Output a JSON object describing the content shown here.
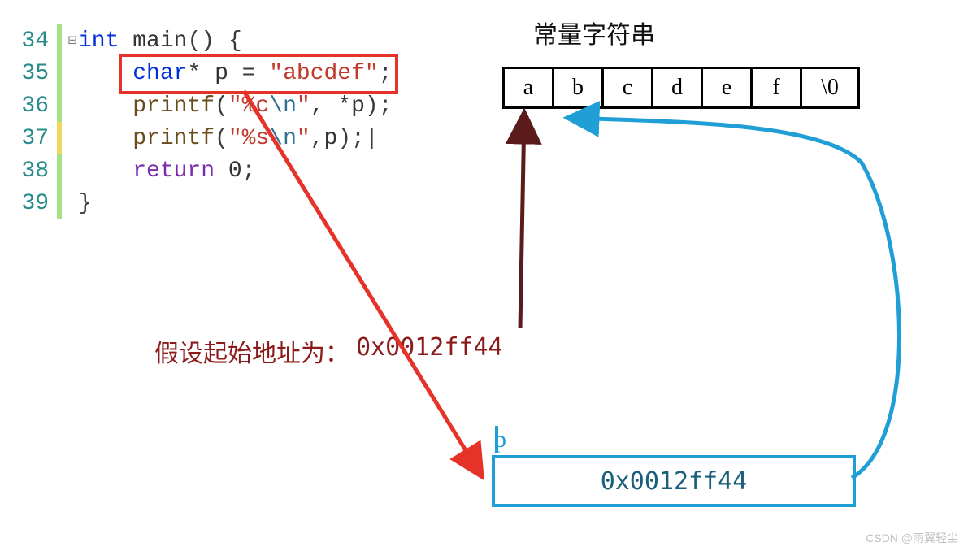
{
  "code": {
    "lines": [
      34,
      35,
      36,
      37,
      38,
      39
    ],
    "kw_int": "int",
    "fn_main": "main",
    "brace_open": "{",
    "brace_close": "}",
    "kw_char": "char",
    "star": "*",
    "id_p": "p",
    "eq": " = ",
    "str_abcdef": "\"abcdef\"",
    "semi": ";",
    "fn_printf": "printf",
    "paren_open": "(",
    "paren_close": ")",
    "fmt_c_open": "\"%c",
    "esc_n": "\\n",
    "fmt_close": "\"",
    "comma": ", ",
    "deref": "*p",
    "fmt_s_open": "\"%s",
    "arg_p": "p",
    "cursor": "|",
    "kw_return": "return",
    "zero": "0"
  },
  "mem": {
    "title": "常量字符串",
    "cells": [
      "a",
      "b",
      "c",
      "d",
      "e",
      "f",
      "\\0"
    ]
  },
  "pointer": {
    "label": "p",
    "value": "0x0012ff44"
  },
  "anno": {
    "label": "假设起始地址为：",
    "addr": "0x0012ff44"
  },
  "watermark": "CSDN @雨翼轻尘",
  "colors": {
    "red": "#E5332A",
    "darkred": "#6B1F1F",
    "blue": "#1F9FD6"
  }
}
